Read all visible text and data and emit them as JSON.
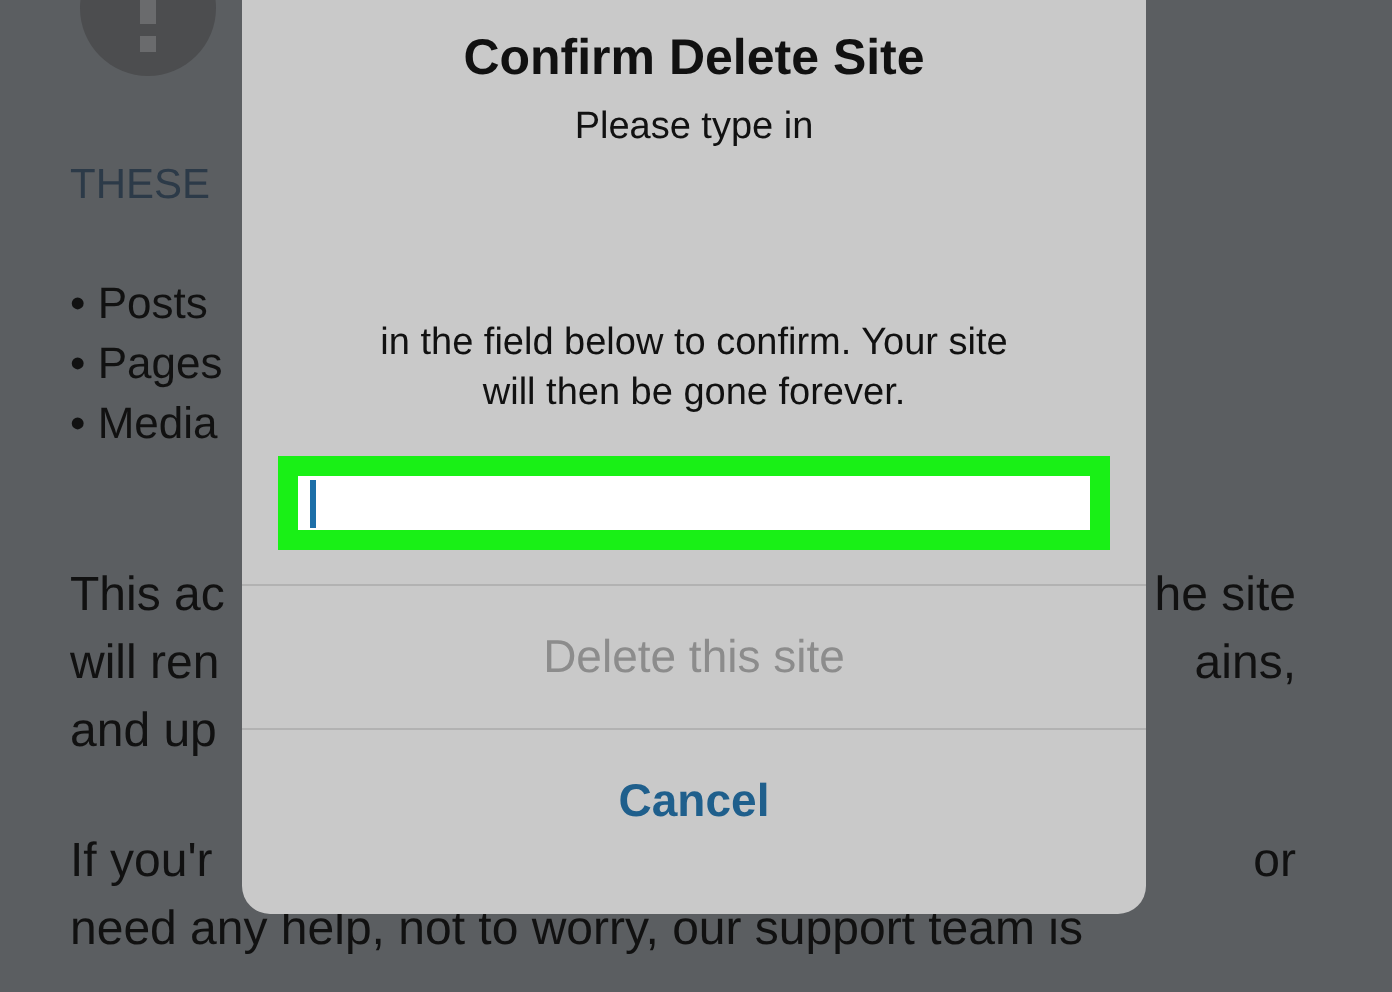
{
  "background_page": {
    "heading": "THESE",
    "bullets": [
      "• Posts",
      "• Pages",
      "• Media"
    ],
    "paragraphs": [
      [
        {
          "left": "This ac",
          "right": "he site"
        },
        {
          "left": "will ren",
          "right": "ains,"
        },
        {
          "left": "and up"
        }
      ],
      [
        {
          "left": "If you'r",
          "right": "or"
        },
        {
          "left": "need any help, not to worry, our support team is"
        }
      ]
    ]
  },
  "dialog": {
    "title": "Confirm Delete Site",
    "message_before": "Please type in",
    "message_after": [
      "in the field below to confirm. Your site",
      "will then be gone forever."
    ],
    "field": {
      "highlighted": true,
      "focused": true
    },
    "buttons": [
      {
        "label": "Delete this site",
        "kind": "action",
        "disabled": true
      },
      {
        "label": "Cancel",
        "kind": "cancel",
        "disabled": false
      }
    ]
  }
}
